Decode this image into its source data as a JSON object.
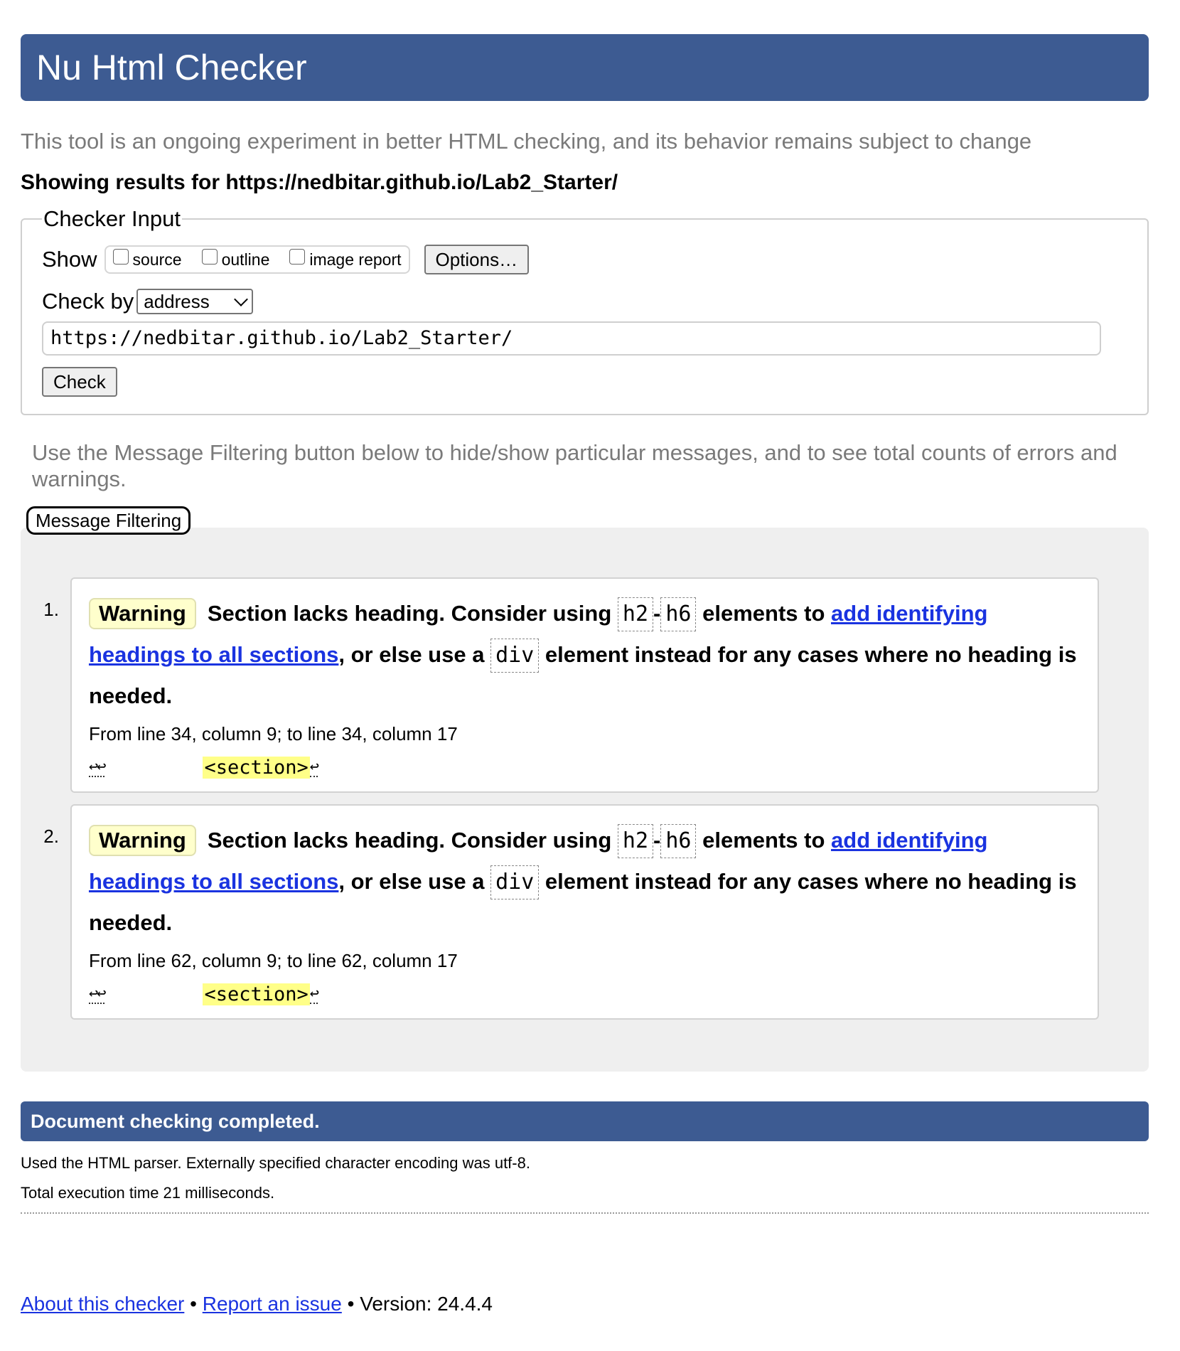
{
  "title": "Nu Html Checker",
  "subtitle": "This tool is an ongoing experiment in better HTML checking, and its behavior remains subject to change",
  "results_for_label": "Showing results for",
  "results_for_url": "https://nedbitar.github.io/Lab2_Starter/",
  "checker_input": {
    "legend": "Checker Input",
    "show_label": "Show",
    "show_options": [
      "source",
      "outline",
      "image report"
    ],
    "options_button": "Options…",
    "check_by_label": "Check by",
    "check_by_value": "address",
    "url_value": "https://nedbitar.github.io/Lab2_Starter/",
    "check_button": "Check"
  },
  "filter_note": "Use the Message Filtering button below to hide/show particular messages, and to see total counts of errors and warnings.",
  "filter_button": "Message Filtering",
  "messages": [
    {
      "num": "1.",
      "type": "Warning",
      "text_1": "Section lacks heading. Consider using",
      "code_1": "h2",
      "dash": "-",
      "code_2": "h6",
      "text_2": "elements to",
      "link": "add identifying headings to all sections",
      "text_3": ", or else use a",
      "code_3": "div",
      "text_4": "element instead for any cases where no heading is needed.",
      "location": "From line 34, column 9; to line 34, column 17",
      "extract_prefix": "↩↩",
      "extract_code": "<section>",
      "extract_suffix": "↩"
    },
    {
      "num": "2.",
      "type": "Warning",
      "text_1": "Section lacks heading. Consider using",
      "code_1": "h2",
      "dash": "-",
      "code_2": "h6",
      "text_2": "elements to",
      "link": "add identifying headings to all sections",
      "text_3": ", or else use a",
      "code_3": "div",
      "text_4": "element instead for any cases where no heading is needed.",
      "location": "From line 62, column 9; to line 62, column 17",
      "extract_prefix": "↩↩",
      "extract_code": "<section>",
      "extract_suffix": "↩"
    }
  ],
  "completed": "Document checking completed.",
  "info_parser": "Used the HTML parser. Externally specified character encoding was utf-8.",
  "info_time": "Total execution time 21 milliseconds.",
  "footer": {
    "about": "About this checker",
    "bullet": "•",
    "report": "Report an issue",
    "version": "Version: 24.4.4"
  }
}
